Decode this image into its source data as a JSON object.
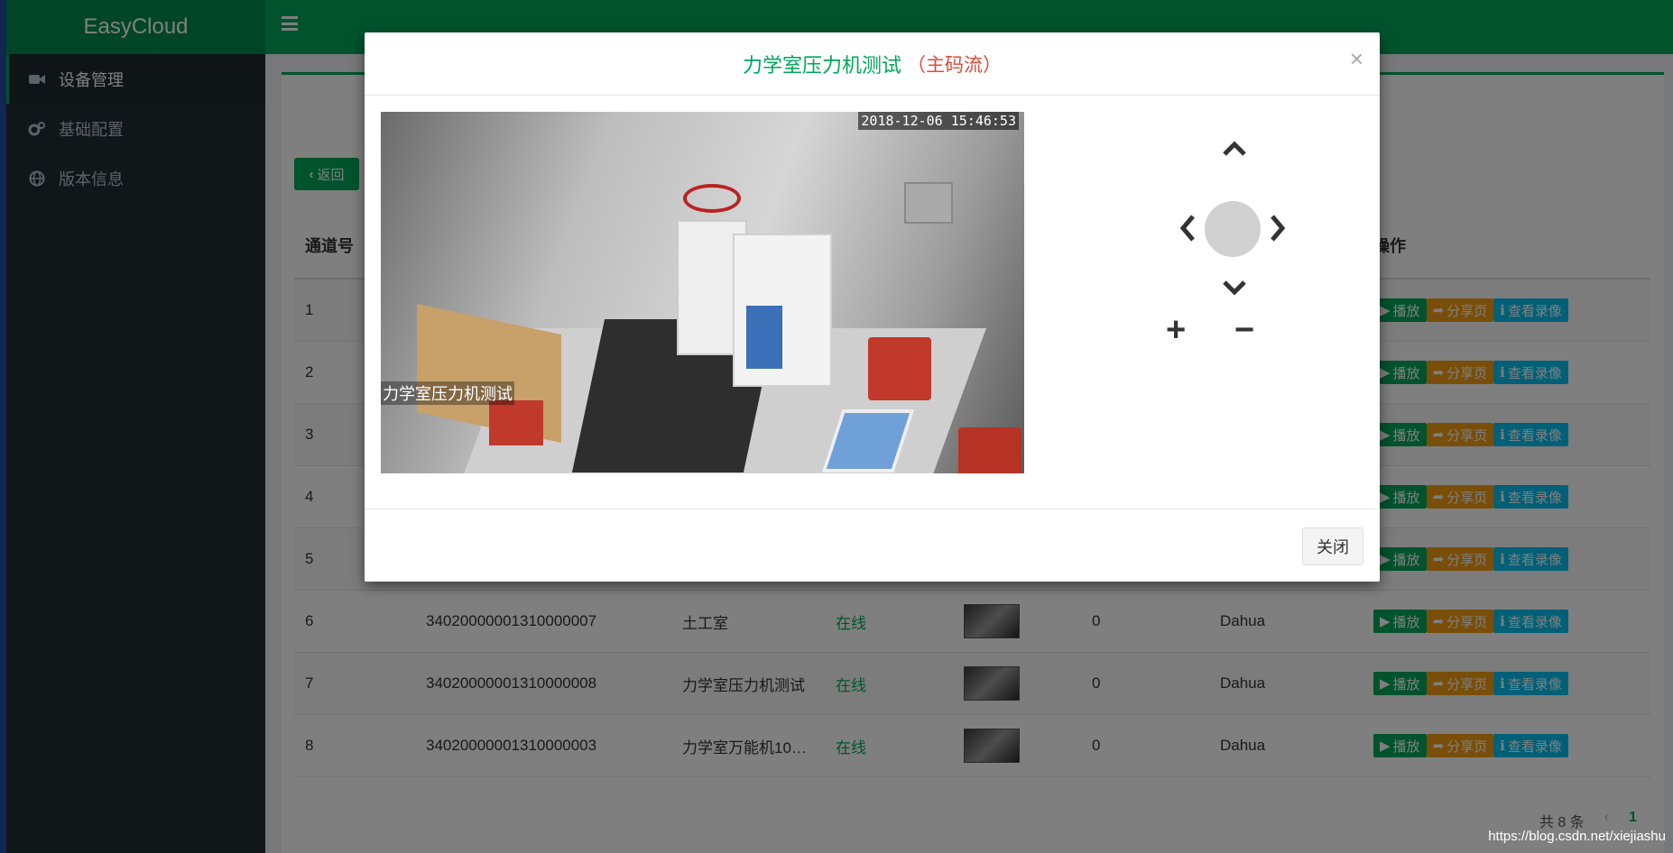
{
  "app": {
    "title": "EasyCloud"
  },
  "sidebar": {
    "items": [
      {
        "label": "设备管理",
        "icon": "video-camera-icon"
      },
      {
        "label": "基础配置",
        "icon": "gears-icon"
      },
      {
        "label": "版本信息",
        "icon": "globe-icon"
      }
    ]
  },
  "toolbar": {
    "back_label": "返回"
  },
  "table": {
    "columns": {
      "channel": "通道号",
      "actions": "操作"
    },
    "rows": [
      {
        "no": "1"
      },
      {
        "no": "2"
      },
      {
        "no": "3"
      },
      {
        "no": "4"
      },
      {
        "no": "5"
      },
      {
        "no": "6",
        "id": "34020000001310000007",
        "name": "土工室",
        "status": "在线",
        "count": "0",
        "vendor": "Dahua"
      },
      {
        "no": "7",
        "id": "34020000001310000008",
        "name": "力学室压力机测试",
        "status": "在线",
        "count": "0",
        "vendor": "Dahua"
      },
      {
        "no": "8",
        "id": "34020000001310000003",
        "name": "力学室万能机10…",
        "status": "在线",
        "count": "0",
        "vendor": "Dahua"
      }
    ],
    "actions": {
      "play": "播放",
      "share": "分享页",
      "record": "查看录像"
    }
  },
  "pager": {
    "total": "共 8 条",
    "prev": "‹",
    "page": "1"
  },
  "modal": {
    "title": "力学室压力机测试",
    "subtitle": "（主码流）",
    "close_x": "×",
    "close_label": "关闭",
    "video": {
      "timestamp": "2018-12-06 15:46:53",
      "label": "力学室压力机测试"
    },
    "ptz": {
      "zoom_in": "+",
      "zoom_out": "−"
    }
  },
  "watermark": "https://blog.csdn.net/xiejiashu",
  "colors": {
    "brand": "#00a65a",
    "sidebar": "#222d32",
    "warning": "#f39c12",
    "info": "#00c0ef",
    "danger": "#dd4b39"
  }
}
